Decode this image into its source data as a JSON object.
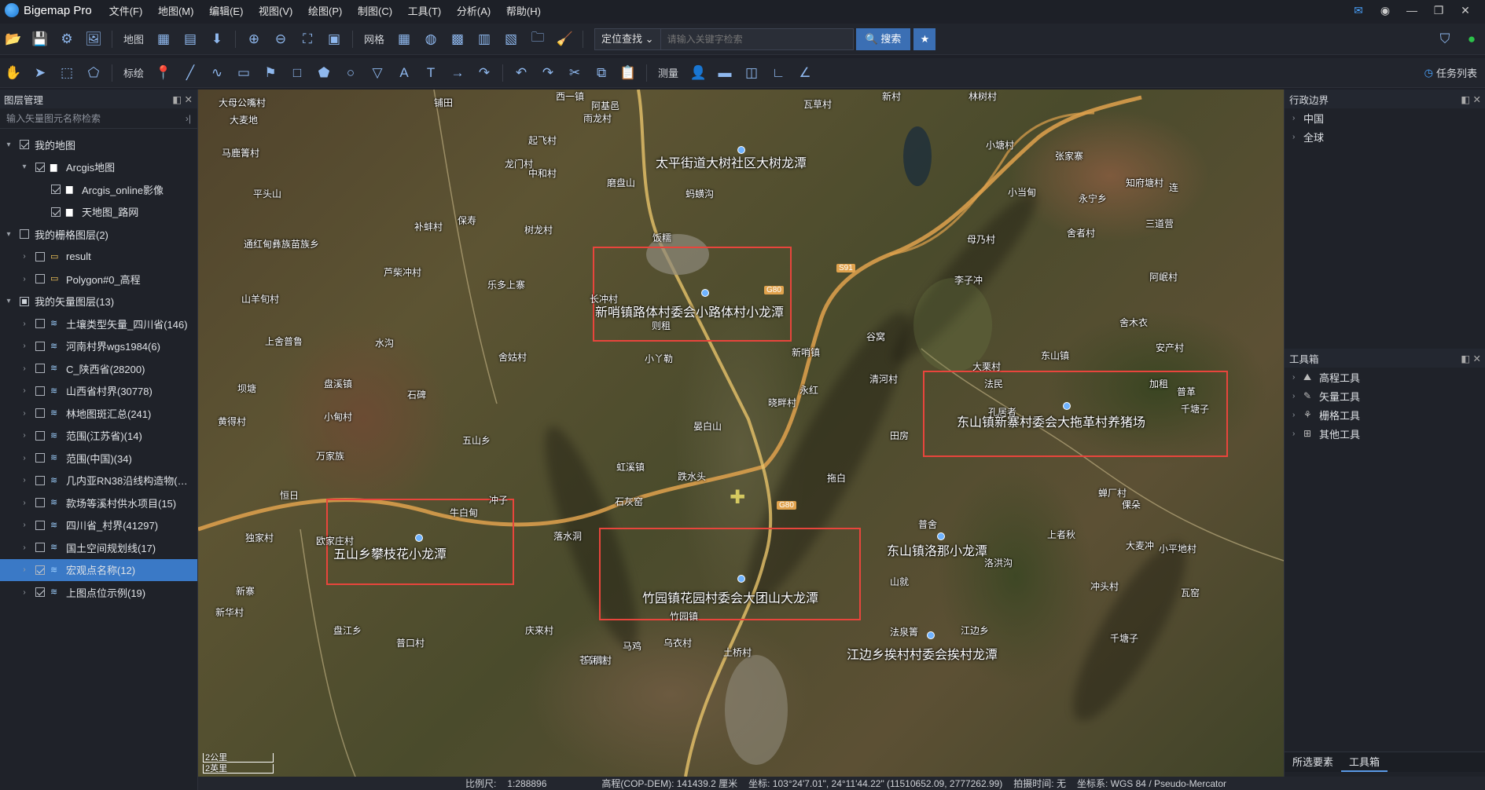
{
  "app": {
    "title": "Bigemap Pro"
  },
  "menu": [
    "文件(F)",
    "地图(M)",
    "编辑(E)",
    "视图(V)",
    "绘图(P)",
    "制图(C)",
    "工具(T)",
    "分析(A)",
    "帮助(H)"
  ],
  "toolbar1": {
    "map_label": "地图",
    "grid_label": "网格",
    "locate_select": "定位查找",
    "search_placeholder": "请输入关键字检索",
    "search_button": "搜索"
  },
  "toolbar2": {
    "mark_label": "标绘",
    "measure_label": "测量",
    "tasklist_label": "任务列表"
  },
  "layer_panel": {
    "title": "图层管理",
    "filter_placeholder": "输入矢量图元名称检索",
    "rows": [
      {
        "label": "我的地图",
        "indent": 0,
        "arrow": "▾",
        "check": "on",
        "icon": ""
      },
      {
        "label": "Arcgis地图",
        "indent": 1,
        "arrow": "▾",
        "check": "on",
        "icon": "folder"
      },
      {
        "label": "Arcgis_online影像",
        "indent": 2,
        "arrow": "",
        "check": "on",
        "icon": "folder"
      },
      {
        "label": "天地图_路网",
        "indent": 2,
        "arrow": "",
        "check": "on",
        "icon": "folder"
      },
      {
        "label": "我的栅格图层(2)",
        "indent": 0,
        "arrow": "▾",
        "check": "off",
        "icon": ""
      },
      {
        "label": "result",
        "indent": 1,
        "arrow": "›",
        "check": "off",
        "icon": "raster"
      },
      {
        "label": "Polygon#0_高程",
        "indent": 1,
        "arrow": "›",
        "check": "off",
        "icon": "raster"
      },
      {
        "label": "我的矢量图层(13)",
        "indent": 0,
        "arrow": "▾",
        "check": "part",
        "icon": ""
      },
      {
        "label": "土壤类型矢量_四川省(146)",
        "indent": 1,
        "arrow": "›",
        "check": "off",
        "icon": "layer"
      },
      {
        "label": "河南村界wgs1984(6)",
        "indent": 1,
        "arrow": "›",
        "check": "off",
        "icon": "layer"
      },
      {
        "label": "C_陕西省(28200)",
        "indent": 1,
        "arrow": "›",
        "check": "off",
        "icon": "layer"
      },
      {
        "label": "山西省村界(30778)",
        "indent": 1,
        "arrow": "›",
        "check": "off",
        "icon": "layer"
      },
      {
        "label": "林地图斑汇总(241)",
        "indent": 1,
        "arrow": "›",
        "check": "off",
        "icon": "layer"
      },
      {
        "label": "范围(江苏省)(14)",
        "indent": 1,
        "arrow": "›",
        "check": "off",
        "icon": "layer"
      },
      {
        "label": "范围(中国)(34)",
        "indent": 1,
        "arrow": "›",
        "check": "off",
        "icon": "layer"
      },
      {
        "label": "几内亚RN38沿线构造物(…",
        "indent": 1,
        "arrow": "›",
        "check": "off",
        "icon": "layer"
      },
      {
        "label": "款场等溪村供水项目(15)",
        "indent": 1,
        "arrow": "›",
        "check": "off",
        "icon": "layer"
      },
      {
        "label": "四川省_村界(41297)",
        "indent": 1,
        "arrow": "›",
        "check": "off",
        "icon": "layer"
      },
      {
        "label": "国土空间规划线(17)",
        "indent": 1,
        "arrow": "›",
        "check": "off",
        "icon": "layer"
      },
      {
        "label": "宏观点名称(12)",
        "indent": 1,
        "arrow": "›",
        "check": "on",
        "icon": "layer",
        "selected": true
      },
      {
        "label": "上图点位示例(19)",
        "indent": 1,
        "arrow": "›",
        "check": "on",
        "icon": "layer"
      }
    ]
  },
  "map": {
    "labels": [
      "大母公嘴村",
      "大麦地",
      "马鹿箐村",
      "平头山",
      "通红甸彝族苗族乡",
      "山羊旬村",
      "上舍普鲁",
      "坝塘",
      "黄得村",
      "恒日",
      "独家村",
      "新寨",
      "新华村",
      "盘江乡",
      "西一镇",
      "铺田",
      "起飞村",
      "龙门村",
      "中和村",
      "阿基邑",
      "雨龙村",
      "瓦草村",
      "新村",
      "林树村",
      "小塘村",
      "张家寨",
      "知府塘村",
      "连",
      "小当甸",
      "永宁乡",
      "三道营",
      "舍者村",
      "母乃村",
      "李子冲",
      "阿岷村",
      "舍木衣",
      "安产村",
      "大栗村",
      "法民",
      "加租",
      "普革",
      "千塘子",
      "孔居者",
      "田房",
      "大麦冲",
      "上者秋",
      "小平地村",
      "洛洪沟",
      "山就",
      "冲头村",
      "瓦窑",
      "法泉箐",
      "江边乡",
      "千塘子",
      "补蚌村",
      "保寿",
      "树龙村",
      "芦柴冲村",
      "乐多上寨",
      "长冲村",
      "水沟",
      "舍姑村",
      "盘溪镇",
      "石碑",
      "小甸村",
      "则租",
      "小丫勒",
      "新哨镇",
      "谷窝",
      "清河村",
      "永红",
      "晓畔村",
      "晏白山",
      "虹溪镇",
      "跌水头",
      "拖白",
      "石灰窑",
      "牛白甸",
      "落水洞",
      "欧家庄村",
      "普口村",
      "苍蒲塘",
      "乌衣村",
      "冲子",
      "竹园镇",
      "土桥村",
      "庆来村",
      "马鸡",
      "乌稠村",
      "五山乡",
      "万家族",
      "磨盘山",
      "蚂蟥沟",
      "饭糯",
      "东山镇",
      "普舍",
      "倮朵",
      "蝉厂村"
    ],
    "callouts": [
      "太平街道大树社区大树龙潭",
      "新哨镇路体村委会小路体村小龙潭",
      "东山镇新寨村委会大拖革村养猪场",
      "五山乡攀枝花小龙潭",
      "竹园镇花园村委会大团山大龙潭",
      "东山镇洛那小龙潭",
      "江边乡挨村村委会挨村龙潭"
    ],
    "scale": {
      "km": "2公里",
      "mi": "2英里"
    },
    "roads": [
      "G80",
      "S91",
      "G80"
    ]
  },
  "right_panel": {
    "admin_title": "行政边界",
    "admin_items": [
      "中国",
      "全球"
    ],
    "toolbox_title": "工具箱",
    "tools": [
      "高程工具",
      "矢量工具",
      "栅格工具",
      "其他工具"
    ],
    "tabs": [
      "所选要素",
      "工具箱"
    ]
  },
  "status": {
    "scale_label": "比例尺:",
    "scale_value": "1:288896",
    "elev": "高程(COP-DEM): 141439.2 厘米",
    "coord": "坐标: 103°24'7.01\", 24°11'44.22\" (11510652.09, 2777262.99)",
    "shot": "拍摄时间: 无",
    "crs": "坐标系: WGS 84 / Pseudo-Mercator"
  },
  "colors": {
    "accent": "#3a79c6",
    "callout_box": "#e8453c",
    "panel": "#1f2229"
  }
}
